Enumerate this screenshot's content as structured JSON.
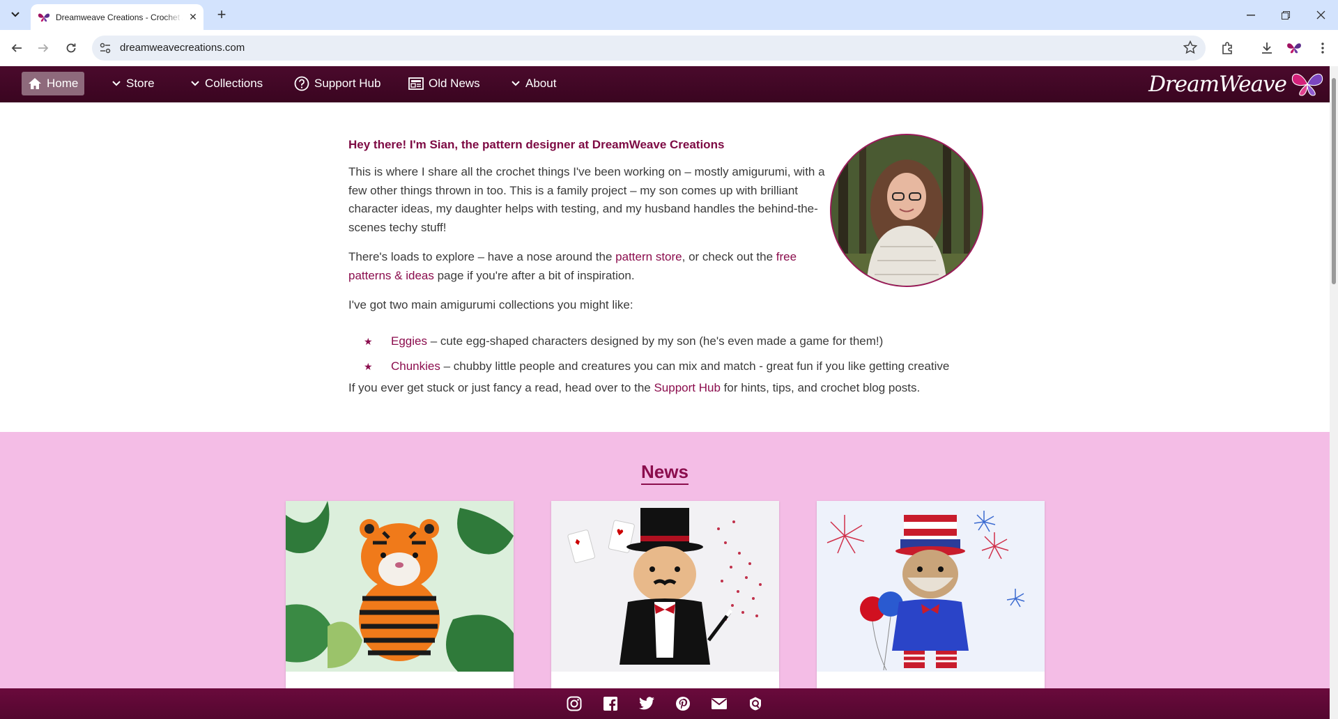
{
  "browser": {
    "tab_title": "Dreamweave Creations - Crochet Amigurumi Patterns",
    "url": "dreamweavecreations.com"
  },
  "nav": {
    "items": [
      {
        "label": "Home",
        "icon": "home-icon"
      },
      {
        "label": "Store",
        "icon": "chevron-down-icon"
      },
      {
        "label": "Collections",
        "icon": "chevron-down-icon"
      },
      {
        "label": "Support Hub",
        "icon": "help-circle-icon"
      },
      {
        "label": "Old News",
        "icon": "newspaper-icon"
      },
      {
        "label": "About",
        "icon": "chevron-down-icon"
      }
    ],
    "logo_text": "DreamWeave"
  },
  "intro": {
    "heading": "Hey there! I'm Sian, the pattern designer at DreamWeave Creations",
    "p1": "This is where I share all the crochet things I've been working on – mostly amigurumi, with a few other things thrown in too. This is a family project – my son comes up with brilliant character ideas, my daughter helps with testing, and my husband handles the behind-the-scenes techy stuff!",
    "p2_a": "There's loads to explore – have a nose around the ",
    "p2_link1": "pattern store",
    "p2_b": ", or check out the ",
    "p2_link2": "free patterns & ideas",
    "p2_c": " page if you're after a bit of inspiration.",
    "p3": "I've got two main amigurumi collections you might like:",
    "bullets": [
      {
        "link": "Eggies",
        "text": " – cute egg-shaped characters designed by my son (he's even made a game for them!)"
      },
      {
        "link": "Chunkies",
        "text": " – chubby little people and creatures you can mix and match - great fun if you like getting creative"
      }
    ],
    "support_a": "If you ever get stuck or just fancy a read, head over to the ",
    "support_link": "Support Hub",
    "support_b": " for hints, tips, and crochet blog posts."
  },
  "news": {
    "title": "News"
  },
  "footer": {
    "icons": [
      "instagram-icon",
      "facebook-icon",
      "twitter-icon",
      "pinterest-icon",
      "email-icon",
      "ravelry-icon"
    ]
  },
  "colors": {
    "brand": "#8b0d4d",
    "nav_bg": "#3a0520",
    "news_bg": "#f4bde6"
  }
}
